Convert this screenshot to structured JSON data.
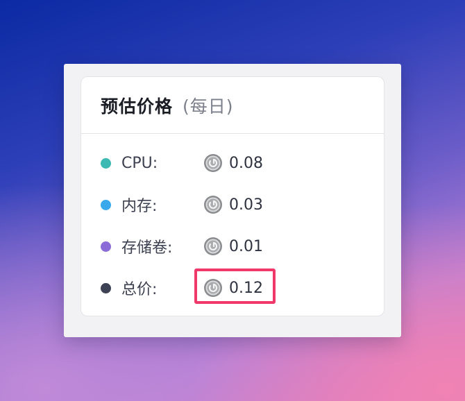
{
  "panel": {
    "title": "预估价格",
    "subtitle": "(每日)"
  },
  "rows": [
    {
      "label": "CPU:",
      "value": "0.08",
      "dot_color": "#3bb9b2",
      "icon": "coin-icon"
    },
    {
      "label": "内存:",
      "value": "0.03",
      "dot_color": "#3aa9ec",
      "icon": "coin-icon"
    },
    {
      "label": "存储卷:",
      "value": "0.01",
      "dot_color": "#8c6cd6",
      "icon": "coin-icon"
    },
    {
      "label": "总价:",
      "value": "0.12",
      "dot_color": "#3d4354",
      "icon": "coin-icon"
    }
  ],
  "colors": {
    "highlight": "#f0386b"
  }
}
